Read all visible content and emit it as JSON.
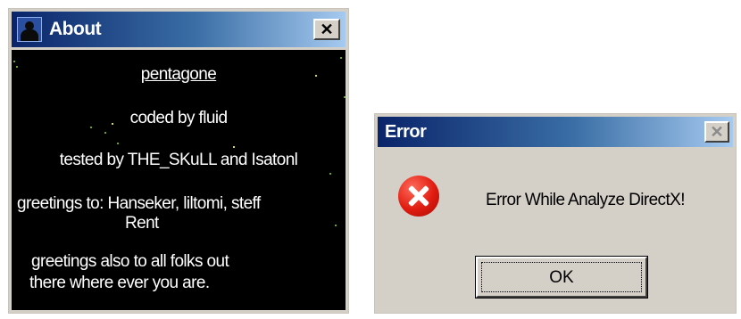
{
  "about_window": {
    "title": "About",
    "close_glyph": "✕",
    "icon": "silhouette-app-icon",
    "lines": [
      "pentagone",
      "coded by fluid",
      "tested by THE_SKuLL and Isatonl",
      "greetings to: Hanseker, liltomi, steff",
      "Rent",
      "greetings also to all folks out",
      "there where ever you are."
    ]
  },
  "error_dialog": {
    "title": "Error",
    "close_glyph": "✕",
    "icon": "error-icon",
    "message": "Error While Analyze DirectX!",
    "ok_label": "OK"
  },
  "colors": {
    "titlebar_start": "#0a246a",
    "titlebar_end": "#a6caf0",
    "dialog_face": "#d4d0c8",
    "about_background": "#000000",
    "error_icon": "#e01c10"
  }
}
